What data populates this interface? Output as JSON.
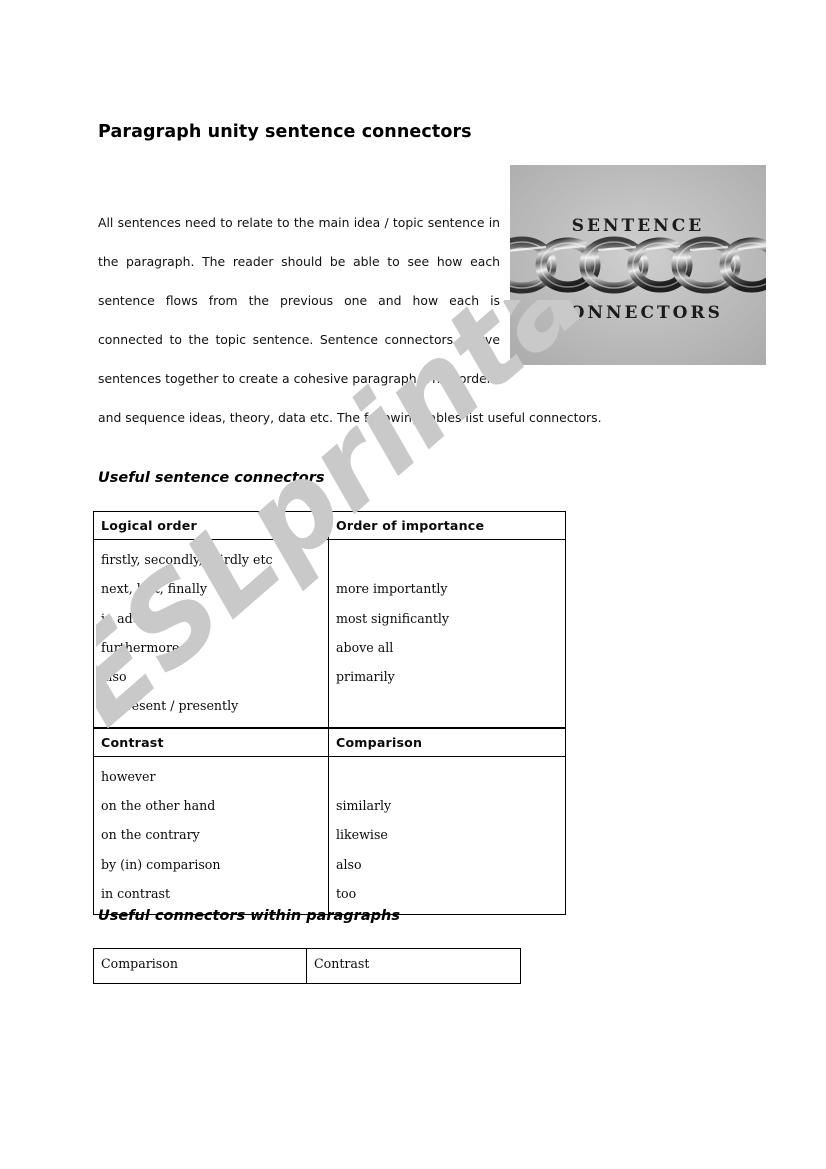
{
  "document": {
    "title": "Paragraph unity sentence connectors",
    "intro_paragraph": "All sentences need to relate to the main idea / topic sentence in the paragraph. The reader should be able to see how each sentence flows from the previous one and how each is connected to the topic sentence. Sentence connectors weave sentences together to create a cohesive paragraph. They order",
    "intro_last_line": "and sequence ideas, theory, data etc. The following tables list useful connectors."
  },
  "figure": {
    "name": "chain-links-photo",
    "top_label": "SENTENCE",
    "bottom_label": "CONNECTORS",
    "background_color": "#b9b9b9"
  },
  "watermark": {
    "text": "ESLprintables.com",
    "color": "#c9c9c9"
  },
  "sections": [
    {
      "heading": "Useful sentence connectors",
      "table": {
        "blocks": [
          {
            "headers": [
              "Logical order",
              "Order of importance"
            ],
            "col1": [
              "firstly, secondly, thirdly etc",
              "next, last, finally",
              "in addition",
              "furthermore",
              "also",
              "at present / presently"
            ],
            "col2": [
              "",
              "more importantly",
              "most significantly",
              "above all",
              "primarily",
              ""
            ]
          },
          {
            "headers": [
              "Contrast",
              "Comparison"
            ],
            "col1": [
              "however",
              "on the other hand",
              "on the contrary",
              "by (in) comparison",
              "in contrast"
            ],
            "col2": [
              "",
              "similarly",
              "likewise",
              "also",
              "too"
            ]
          }
        ]
      }
    },
    {
      "heading": "Useful connectors within paragraphs",
      "table": {
        "blocks": [
          {
            "headers": [
              "Comparison",
              "Contrast"
            ],
            "col1": [],
            "col2": []
          }
        ]
      }
    }
  ]
}
